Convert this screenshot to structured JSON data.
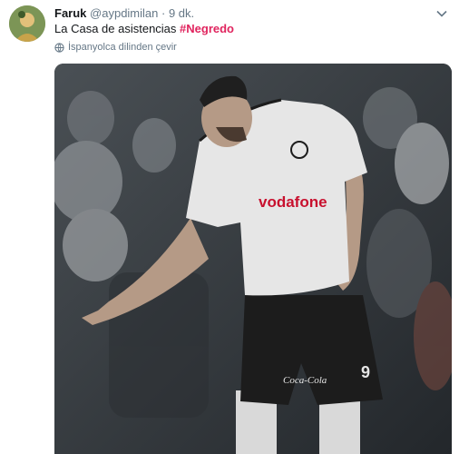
{
  "tweet": {
    "display_name": "Faruk",
    "handle": "@aypdimilan",
    "separator": "·",
    "time": "9 dk.",
    "text_before_hashtag": "La Casa de asistencias ",
    "hashtag": "#Negredo",
    "translate_label": "İspanyolca dilinden çevir"
  },
  "media": {
    "jersey_sponsor": "vodafone",
    "shorts_sponsor": "Coca-Cola",
    "shorts_number": "9"
  },
  "colors": {
    "hashtag": "#e0245e",
    "muted": "#657786",
    "jersey": "#e6e6e6",
    "shorts": "#1c1c1c"
  }
}
